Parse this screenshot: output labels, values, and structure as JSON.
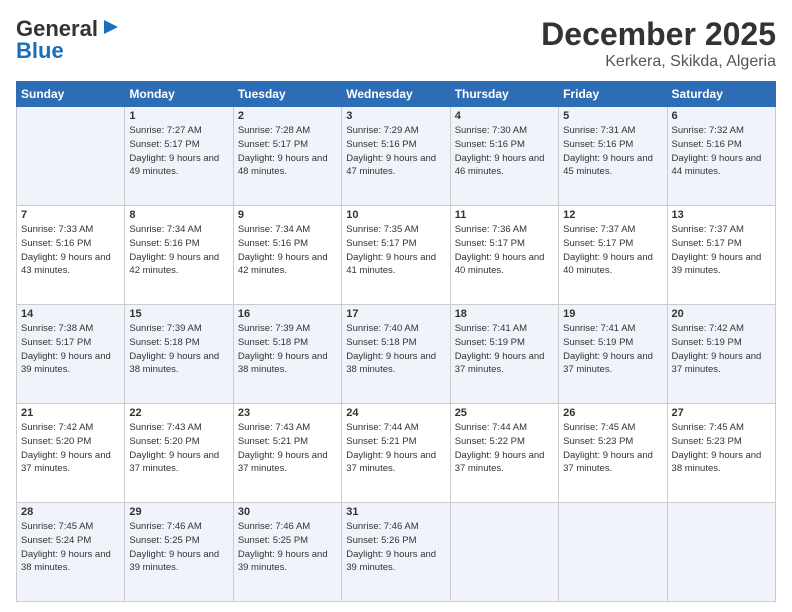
{
  "header": {
    "logo_line1": "General",
    "logo_line2": "Blue",
    "month": "December 2025",
    "location": "Kerkera, Skikda, Algeria"
  },
  "weekdays": [
    "Sunday",
    "Monday",
    "Tuesday",
    "Wednesday",
    "Thursday",
    "Friday",
    "Saturday"
  ],
  "weeks": [
    [
      {
        "day": "",
        "sunrise": "",
        "sunset": "",
        "daylight": ""
      },
      {
        "day": "1",
        "sunrise": "Sunrise: 7:27 AM",
        "sunset": "Sunset: 5:17 PM",
        "daylight": "Daylight: 9 hours and 49 minutes."
      },
      {
        "day": "2",
        "sunrise": "Sunrise: 7:28 AM",
        "sunset": "Sunset: 5:17 PM",
        "daylight": "Daylight: 9 hours and 48 minutes."
      },
      {
        "day": "3",
        "sunrise": "Sunrise: 7:29 AM",
        "sunset": "Sunset: 5:16 PM",
        "daylight": "Daylight: 9 hours and 47 minutes."
      },
      {
        "day": "4",
        "sunrise": "Sunrise: 7:30 AM",
        "sunset": "Sunset: 5:16 PM",
        "daylight": "Daylight: 9 hours and 46 minutes."
      },
      {
        "day": "5",
        "sunrise": "Sunrise: 7:31 AM",
        "sunset": "Sunset: 5:16 PM",
        "daylight": "Daylight: 9 hours and 45 minutes."
      },
      {
        "day": "6",
        "sunrise": "Sunrise: 7:32 AM",
        "sunset": "Sunset: 5:16 PM",
        "daylight": "Daylight: 9 hours and 44 minutes."
      }
    ],
    [
      {
        "day": "7",
        "sunrise": "Sunrise: 7:33 AM",
        "sunset": "Sunset: 5:16 PM",
        "daylight": "Daylight: 9 hours and 43 minutes."
      },
      {
        "day": "8",
        "sunrise": "Sunrise: 7:34 AM",
        "sunset": "Sunset: 5:16 PM",
        "daylight": "Daylight: 9 hours and 42 minutes."
      },
      {
        "day": "9",
        "sunrise": "Sunrise: 7:34 AM",
        "sunset": "Sunset: 5:16 PM",
        "daylight": "Daylight: 9 hours and 42 minutes."
      },
      {
        "day": "10",
        "sunrise": "Sunrise: 7:35 AM",
        "sunset": "Sunset: 5:17 PM",
        "daylight": "Daylight: 9 hours and 41 minutes."
      },
      {
        "day": "11",
        "sunrise": "Sunrise: 7:36 AM",
        "sunset": "Sunset: 5:17 PM",
        "daylight": "Daylight: 9 hours and 40 minutes."
      },
      {
        "day": "12",
        "sunrise": "Sunrise: 7:37 AM",
        "sunset": "Sunset: 5:17 PM",
        "daylight": "Daylight: 9 hours and 40 minutes."
      },
      {
        "day": "13",
        "sunrise": "Sunrise: 7:37 AM",
        "sunset": "Sunset: 5:17 PM",
        "daylight": "Daylight: 9 hours and 39 minutes."
      }
    ],
    [
      {
        "day": "14",
        "sunrise": "Sunrise: 7:38 AM",
        "sunset": "Sunset: 5:17 PM",
        "daylight": "Daylight: 9 hours and 39 minutes."
      },
      {
        "day": "15",
        "sunrise": "Sunrise: 7:39 AM",
        "sunset": "Sunset: 5:18 PM",
        "daylight": "Daylight: 9 hours and 38 minutes."
      },
      {
        "day": "16",
        "sunrise": "Sunrise: 7:39 AM",
        "sunset": "Sunset: 5:18 PM",
        "daylight": "Daylight: 9 hours and 38 minutes."
      },
      {
        "day": "17",
        "sunrise": "Sunrise: 7:40 AM",
        "sunset": "Sunset: 5:18 PM",
        "daylight": "Daylight: 9 hours and 38 minutes."
      },
      {
        "day": "18",
        "sunrise": "Sunrise: 7:41 AM",
        "sunset": "Sunset: 5:19 PM",
        "daylight": "Daylight: 9 hours and 37 minutes."
      },
      {
        "day": "19",
        "sunrise": "Sunrise: 7:41 AM",
        "sunset": "Sunset: 5:19 PM",
        "daylight": "Daylight: 9 hours and 37 minutes."
      },
      {
        "day": "20",
        "sunrise": "Sunrise: 7:42 AM",
        "sunset": "Sunset: 5:19 PM",
        "daylight": "Daylight: 9 hours and 37 minutes."
      }
    ],
    [
      {
        "day": "21",
        "sunrise": "Sunrise: 7:42 AM",
        "sunset": "Sunset: 5:20 PM",
        "daylight": "Daylight: 9 hours and 37 minutes."
      },
      {
        "day": "22",
        "sunrise": "Sunrise: 7:43 AM",
        "sunset": "Sunset: 5:20 PM",
        "daylight": "Daylight: 9 hours and 37 minutes."
      },
      {
        "day": "23",
        "sunrise": "Sunrise: 7:43 AM",
        "sunset": "Sunset: 5:21 PM",
        "daylight": "Daylight: 9 hours and 37 minutes."
      },
      {
        "day": "24",
        "sunrise": "Sunrise: 7:44 AM",
        "sunset": "Sunset: 5:21 PM",
        "daylight": "Daylight: 9 hours and 37 minutes."
      },
      {
        "day": "25",
        "sunrise": "Sunrise: 7:44 AM",
        "sunset": "Sunset: 5:22 PM",
        "daylight": "Daylight: 9 hours and 37 minutes."
      },
      {
        "day": "26",
        "sunrise": "Sunrise: 7:45 AM",
        "sunset": "Sunset: 5:23 PM",
        "daylight": "Daylight: 9 hours and 37 minutes."
      },
      {
        "day": "27",
        "sunrise": "Sunrise: 7:45 AM",
        "sunset": "Sunset: 5:23 PM",
        "daylight": "Daylight: 9 hours and 38 minutes."
      }
    ],
    [
      {
        "day": "28",
        "sunrise": "Sunrise: 7:45 AM",
        "sunset": "Sunset: 5:24 PM",
        "daylight": "Daylight: 9 hours and 38 minutes."
      },
      {
        "day": "29",
        "sunrise": "Sunrise: 7:46 AM",
        "sunset": "Sunset: 5:25 PM",
        "daylight": "Daylight: 9 hours and 39 minutes."
      },
      {
        "day": "30",
        "sunrise": "Sunrise: 7:46 AM",
        "sunset": "Sunset: 5:25 PM",
        "daylight": "Daylight: 9 hours and 39 minutes."
      },
      {
        "day": "31",
        "sunrise": "Sunrise: 7:46 AM",
        "sunset": "Sunset: 5:26 PM",
        "daylight": "Daylight: 9 hours and 39 minutes."
      },
      {
        "day": "",
        "sunrise": "",
        "sunset": "",
        "daylight": ""
      },
      {
        "day": "",
        "sunrise": "",
        "sunset": "",
        "daylight": ""
      },
      {
        "day": "",
        "sunrise": "",
        "sunset": "",
        "daylight": ""
      }
    ]
  ]
}
